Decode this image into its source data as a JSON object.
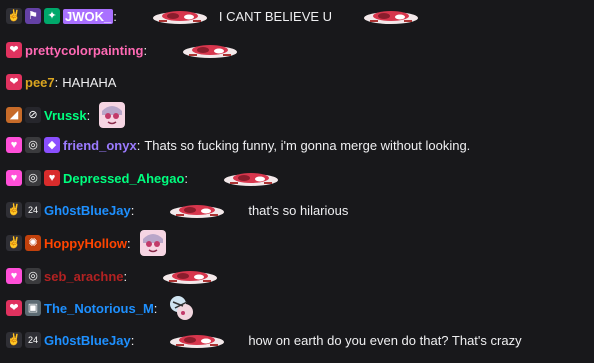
{
  "messages": [
    {
      "badges": [
        "subscriber-badge",
        "mod-badge",
        "bits-badge"
      ],
      "username": "JWOK_",
      "color": "#ffffff",
      "username_bg": "#a970ff",
      "emote": "red-car-emote",
      "text": "I CANT BELIEVE U",
      "trailing_emote": "red-car-emote"
    },
    {
      "badges": [
        "heart-badge"
      ],
      "username": "prettycolorpainting",
      "color": "#ff69b4",
      "emote": "red-car-emote",
      "text": ""
    },
    {
      "badges": [
        "heart-badge"
      ],
      "username": "pee7",
      "color": "#daa520",
      "text": "HAHAHA"
    },
    {
      "badges": [
        "pizza-badge",
        "no-audio-badge"
      ],
      "username": "Vrussk",
      "color": "#00ff7f",
      "emote": "anime-girl-emote",
      "text": ""
    },
    {
      "badges": [
        "pink-heart-badge",
        "gift-badge",
        "purple-gem-badge"
      ],
      "username": "friend_onyx",
      "color": "#9b7bff",
      "text": "Thats so fucking funny, i'm gonna merge without looking."
    },
    {
      "badges": [
        "pink-heart-badge",
        "gift-badge",
        "red-heart-badge"
      ],
      "username": "Depressed_Ahegao",
      "color": "#00ff7f",
      "emote": "red-car-emote",
      "text": ""
    },
    {
      "badges": [
        "subscriber-badge",
        "24-badge"
      ],
      "username": "Gh0stBlueJay",
      "color": "#1e90ff",
      "emote": "red-car-emote",
      "text": "that's so hilarious"
    },
    {
      "badges": [
        "subscriber-badge",
        "orange-badge"
      ],
      "username": "HoppyHollow",
      "color": "#ff4500",
      "emote": "anime-girl-emote",
      "text": ""
    },
    {
      "badges": [
        "pink-heart-badge",
        "gift-badge"
      ],
      "username": "seb_arachne",
      "color": "#b22222",
      "emote": "red-car-emote",
      "text": ""
    },
    {
      "badges": [
        "heart-badge",
        "gift-box-badge"
      ],
      "username": "The_Notorious_M",
      "color": "#1e90ff",
      "emote": "mixed-emote",
      "text": ""
    },
    {
      "badges": [
        "subscriber-badge",
        "24-badge"
      ],
      "username": "Gh0stBlueJay",
      "color": "#1e90ff",
      "emote": "red-car-emote",
      "text": "how on earth do you even do that? That's crazy"
    }
  ],
  "separator": ":",
  "icons": {
    "subscriber-badge": "✌",
    "mod-badge": "⚑",
    "bits-badge": "✦",
    "heart-badge": "❤",
    "pink-heart-badge": "♥",
    "pizza-badge": "◢",
    "no-audio-badge": "⊘",
    "gift-badge": "◎",
    "purple-gem-badge": "◆",
    "red-heart-badge": "♥",
    "24-badge": "24",
    "orange-badge": "✺",
    "gift-box-badge": "▣"
  },
  "colors": {
    "background": "#18181b",
    "text": "#efeff1"
  }
}
